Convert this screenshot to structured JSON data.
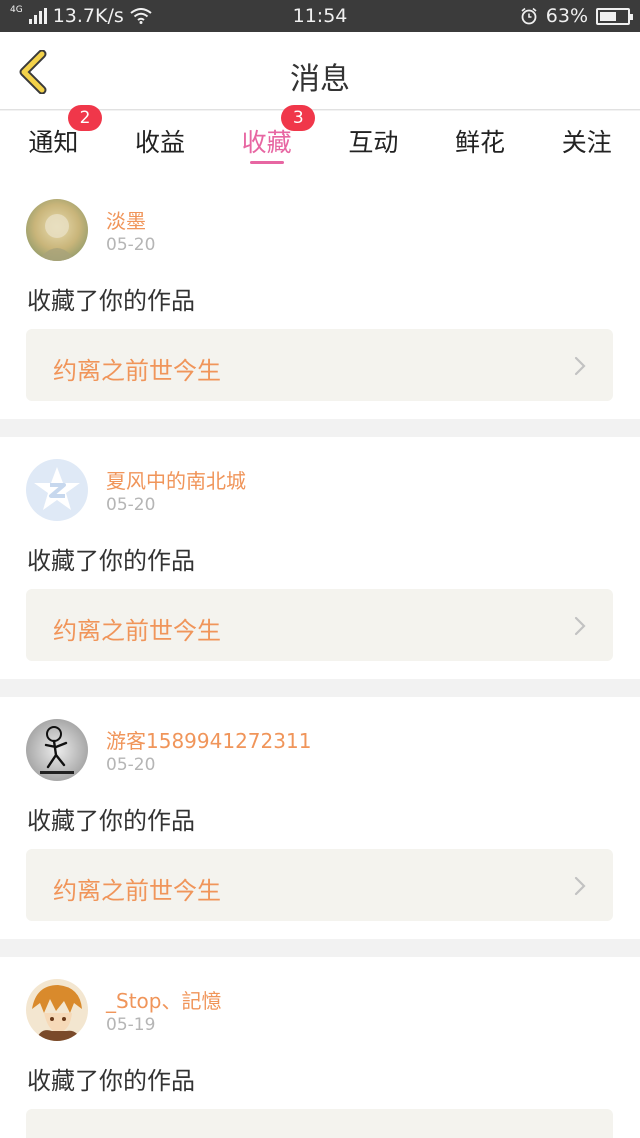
{
  "status_bar": {
    "network_tag": "4G",
    "speed": "13.7K/s",
    "time": "11:54",
    "battery": "63%",
    "battery_level": 0.63
  },
  "nav": {
    "title": "消息"
  },
  "tabs": [
    {
      "label": "通知",
      "badge": "2"
    },
    {
      "label": "收益"
    },
    {
      "label": "收藏",
      "badge": "3",
      "active": true
    },
    {
      "label": "互动"
    },
    {
      "label": "鲜花"
    },
    {
      "label": "关注"
    }
  ],
  "accent_color": "#e766a2",
  "name_color": "#f0955a",
  "badge_color": "#f0374a",
  "items": [
    {
      "name": "淡墨",
      "date": "05-20",
      "action": "收藏了你的作品",
      "work": "约离之前世今生",
      "avatar_icon": "photo-avatar-icon"
    },
    {
      "name": "夏风中的南北城",
      "date": "05-20",
      "action": "收藏了你的作品",
      "work": "约离之前世今生",
      "avatar_icon": "qq-star-avatar-icon"
    },
    {
      "name": "游客1589941272311",
      "date": "05-20",
      "action": "收藏了你的作品",
      "work": "约离之前世今生",
      "avatar_icon": "stickman-avatar-icon"
    },
    {
      "name": "_Stop、記憶",
      "date": "05-19",
      "action": "收藏了你的作品",
      "work": "",
      "avatar_icon": "anime-avatar-icon"
    }
  ]
}
